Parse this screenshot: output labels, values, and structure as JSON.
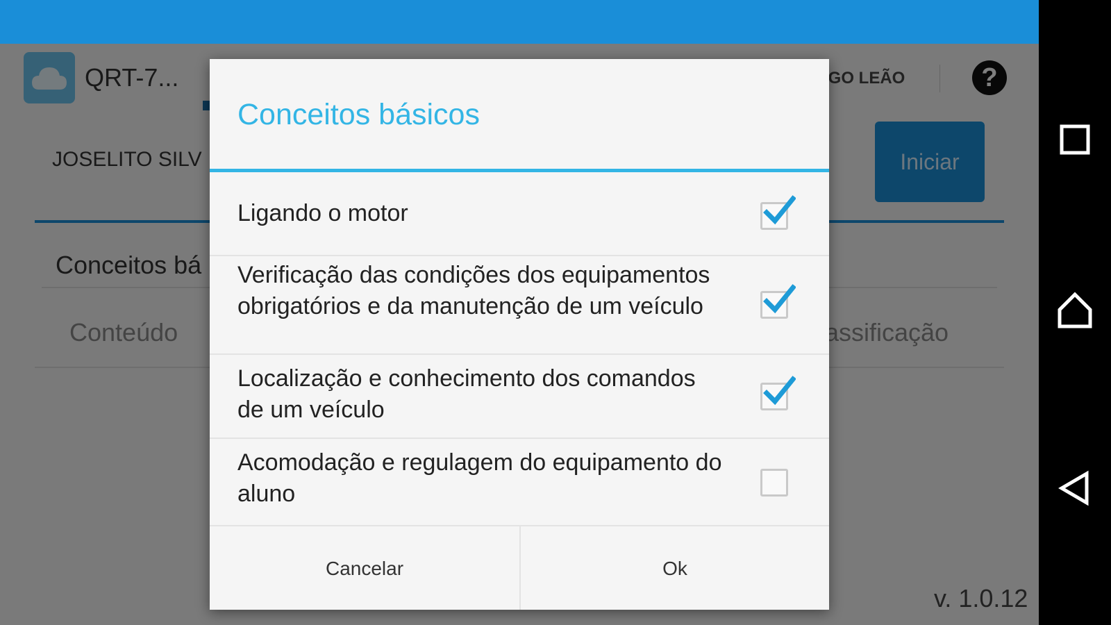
{
  "app": {
    "title": "QRT-7...",
    "user": "DIOGO LEÃO",
    "help": "?",
    "student_name": "JOSELITO SILV",
    "start_label": "Iniciar",
    "section_title": "Conceitos bá",
    "col_content": "Conteúdo",
    "col_class": "lassificação",
    "version": "v. 1.0.12"
  },
  "dialog": {
    "title": "Conceitos básicos",
    "items": [
      {
        "label": "Ligando o motor",
        "checked": true
      },
      {
        "label": "Verificação das condições dos equipamentos obrigatórios e da manutenção de um veículo",
        "checked": true
      },
      {
        "label": "Localização e conhecimento dos comandos de um veículo",
        "checked": true
      },
      {
        "label": "Acomodação e regulagem do equipamento do aluno",
        "checked": false
      }
    ],
    "cancel_label": "Cancelar",
    "ok_label": "Ok"
  },
  "nav": {
    "recents_icon": "square-icon",
    "home_icon": "home-icon",
    "back_icon": "back-triangle-icon"
  },
  "colors": {
    "status_bar": "#1a8ed8",
    "accent": "#33b5e5",
    "check": "#1e9bd7"
  }
}
